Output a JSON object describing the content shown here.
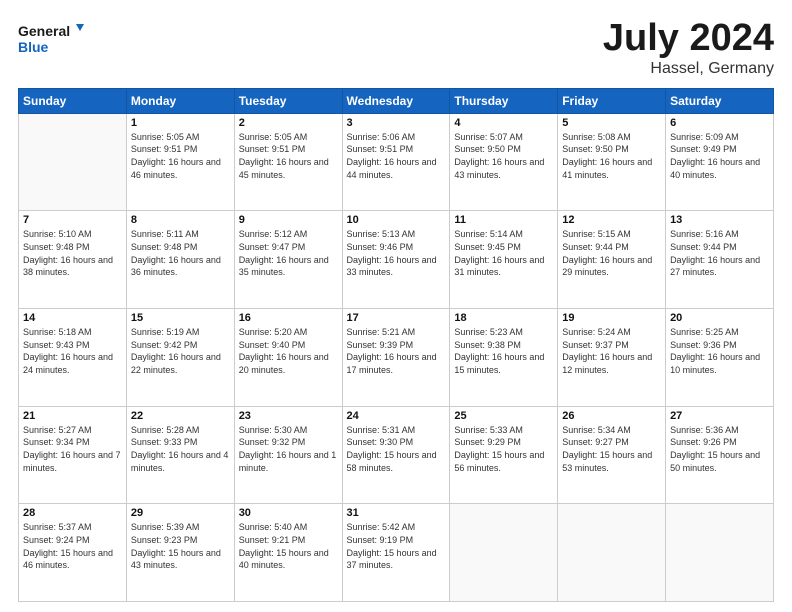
{
  "logo": {
    "line1": "General",
    "line2": "Blue"
  },
  "title": {
    "month": "July 2024",
    "location": "Hassel, Germany"
  },
  "headers": [
    "Sunday",
    "Monday",
    "Tuesday",
    "Wednesday",
    "Thursday",
    "Friday",
    "Saturday"
  ],
  "weeks": [
    [
      {
        "day": "",
        "sunrise": "",
        "sunset": "",
        "daylight": ""
      },
      {
        "day": "1",
        "sunrise": "Sunrise: 5:05 AM",
        "sunset": "Sunset: 9:51 PM",
        "daylight": "Daylight: 16 hours and 46 minutes."
      },
      {
        "day": "2",
        "sunrise": "Sunrise: 5:05 AM",
        "sunset": "Sunset: 9:51 PM",
        "daylight": "Daylight: 16 hours and 45 minutes."
      },
      {
        "day": "3",
        "sunrise": "Sunrise: 5:06 AM",
        "sunset": "Sunset: 9:51 PM",
        "daylight": "Daylight: 16 hours and 44 minutes."
      },
      {
        "day": "4",
        "sunrise": "Sunrise: 5:07 AM",
        "sunset": "Sunset: 9:50 PM",
        "daylight": "Daylight: 16 hours and 43 minutes."
      },
      {
        "day": "5",
        "sunrise": "Sunrise: 5:08 AM",
        "sunset": "Sunset: 9:50 PM",
        "daylight": "Daylight: 16 hours and 41 minutes."
      },
      {
        "day": "6",
        "sunrise": "Sunrise: 5:09 AM",
        "sunset": "Sunset: 9:49 PM",
        "daylight": "Daylight: 16 hours and 40 minutes."
      }
    ],
    [
      {
        "day": "7",
        "sunrise": "Sunrise: 5:10 AM",
        "sunset": "Sunset: 9:48 PM",
        "daylight": "Daylight: 16 hours and 38 minutes."
      },
      {
        "day": "8",
        "sunrise": "Sunrise: 5:11 AM",
        "sunset": "Sunset: 9:48 PM",
        "daylight": "Daylight: 16 hours and 36 minutes."
      },
      {
        "day": "9",
        "sunrise": "Sunrise: 5:12 AM",
        "sunset": "Sunset: 9:47 PM",
        "daylight": "Daylight: 16 hours and 35 minutes."
      },
      {
        "day": "10",
        "sunrise": "Sunrise: 5:13 AM",
        "sunset": "Sunset: 9:46 PM",
        "daylight": "Daylight: 16 hours and 33 minutes."
      },
      {
        "day": "11",
        "sunrise": "Sunrise: 5:14 AM",
        "sunset": "Sunset: 9:45 PM",
        "daylight": "Daylight: 16 hours and 31 minutes."
      },
      {
        "day": "12",
        "sunrise": "Sunrise: 5:15 AM",
        "sunset": "Sunset: 9:44 PM",
        "daylight": "Daylight: 16 hours and 29 minutes."
      },
      {
        "day": "13",
        "sunrise": "Sunrise: 5:16 AM",
        "sunset": "Sunset: 9:44 PM",
        "daylight": "Daylight: 16 hours and 27 minutes."
      }
    ],
    [
      {
        "day": "14",
        "sunrise": "Sunrise: 5:18 AM",
        "sunset": "Sunset: 9:43 PM",
        "daylight": "Daylight: 16 hours and 24 minutes."
      },
      {
        "day": "15",
        "sunrise": "Sunrise: 5:19 AM",
        "sunset": "Sunset: 9:42 PM",
        "daylight": "Daylight: 16 hours and 22 minutes."
      },
      {
        "day": "16",
        "sunrise": "Sunrise: 5:20 AM",
        "sunset": "Sunset: 9:40 PM",
        "daylight": "Daylight: 16 hours and 20 minutes."
      },
      {
        "day": "17",
        "sunrise": "Sunrise: 5:21 AM",
        "sunset": "Sunset: 9:39 PM",
        "daylight": "Daylight: 16 hours and 17 minutes."
      },
      {
        "day": "18",
        "sunrise": "Sunrise: 5:23 AM",
        "sunset": "Sunset: 9:38 PM",
        "daylight": "Daylight: 16 hours and 15 minutes."
      },
      {
        "day": "19",
        "sunrise": "Sunrise: 5:24 AM",
        "sunset": "Sunset: 9:37 PM",
        "daylight": "Daylight: 16 hours and 12 minutes."
      },
      {
        "day": "20",
        "sunrise": "Sunrise: 5:25 AM",
        "sunset": "Sunset: 9:36 PM",
        "daylight": "Daylight: 16 hours and 10 minutes."
      }
    ],
    [
      {
        "day": "21",
        "sunrise": "Sunrise: 5:27 AM",
        "sunset": "Sunset: 9:34 PM",
        "daylight": "Daylight: 16 hours and 7 minutes."
      },
      {
        "day": "22",
        "sunrise": "Sunrise: 5:28 AM",
        "sunset": "Sunset: 9:33 PM",
        "daylight": "Daylight: 16 hours and 4 minutes."
      },
      {
        "day": "23",
        "sunrise": "Sunrise: 5:30 AM",
        "sunset": "Sunset: 9:32 PM",
        "daylight": "Daylight: 16 hours and 1 minute."
      },
      {
        "day": "24",
        "sunrise": "Sunrise: 5:31 AM",
        "sunset": "Sunset: 9:30 PM",
        "daylight": "Daylight: 15 hours and 58 minutes."
      },
      {
        "day": "25",
        "sunrise": "Sunrise: 5:33 AM",
        "sunset": "Sunset: 9:29 PM",
        "daylight": "Daylight: 15 hours and 56 minutes."
      },
      {
        "day": "26",
        "sunrise": "Sunrise: 5:34 AM",
        "sunset": "Sunset: 9:27 PM",
        "daylight": "Daylight: 15 hours and 53 minutes."
      },
      {
        "day": "27",
        "sunrise": "Sunrise: 5:36 AM",
        "sunset": "Sunset: 9:26 PM",
        "daylight": "Daylight: 15 hours and 50 minutes."
      }
    ],
    [
      {
        "day": "28",
        "sunrise": "Sunrise: 5:37 AM",
        "sunset": "Sunset: 9:24 PM",
        "daylight": "Daylight: 15 hours and 46 minutes."
      },
      {
        "day": "29",
        "sunrise": "Sunrise: 5:39 AM",
        "sunset": "Sunset: 9:23 PM",
        "daylight": "Daylight: 15 hours and 43 minutes."
      },
      {
        "day": "30",
        "sunrise": "Sunrise: 5:40 AM",
        "sunset": "Sunset: 9:21 PM",
        "daylight": "Daylight: 15 hours and 40 minutes."
      },
      {
        "day": "31",
        "sunrise": "Sunrise: 5:42 AM",
        "sunset": "Sunset: 9:19 PM",
        "daylight": "Daylight: 15 hours and 37 minutes."
      },
      {
        "day": "",
        "sunrise": "",
        "sunset": "",
        "daylight": ""
      },
      {
        "day": "",
        "sunrise": "",
        "sunset": "",
        "daylight": ""
      },
      {
        "day": "",
        "sunrise": "",
        "sunset": "",
        "daylight": ""
      }
    ]
  ]
}
